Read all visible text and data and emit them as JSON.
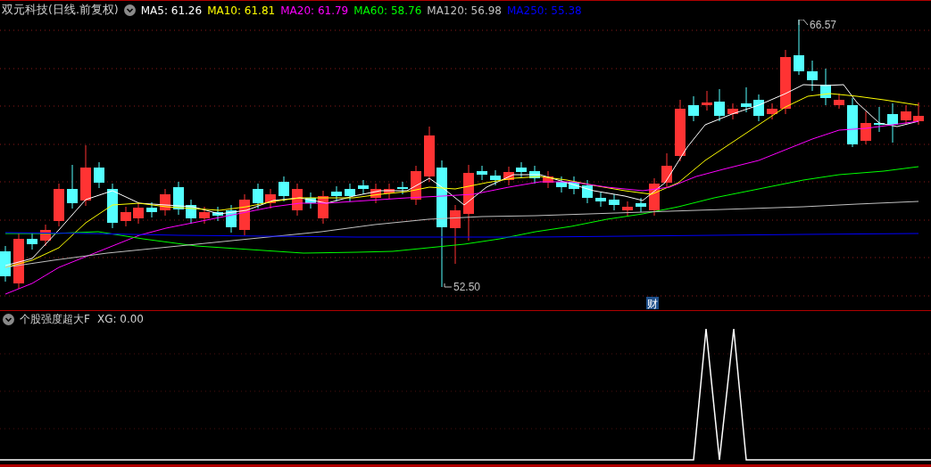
{
  "title": "双元科技(日线.前复权)",
  "moving_averages": [
    {
      "label": "MA5: 61.26",
      "color": "#ffffff"
    },
    {
      "label": "MA10: 61.81",
      "color": "#ffff00"
    },
    {
      "label": "MA20: 61.79",
      "color": "#ff00ff"
    },
    {
      "label": "MA60: 58.76",
      "color": "#00ff00"
    },
    {
      "label": "MA120: 56.98",
      "color": "#c0c0c0"
    },
    {
      "label": "MA250: 55.38",
      "color": "#0000ff"
    }
  ],
  "high_label": "66.57",
  "low_label": "52.50",
  "event_marker": "财",
  "indicator": {
    "name": "个股强度超大F",
    "reading": "XG: 0.00"
  }
}
